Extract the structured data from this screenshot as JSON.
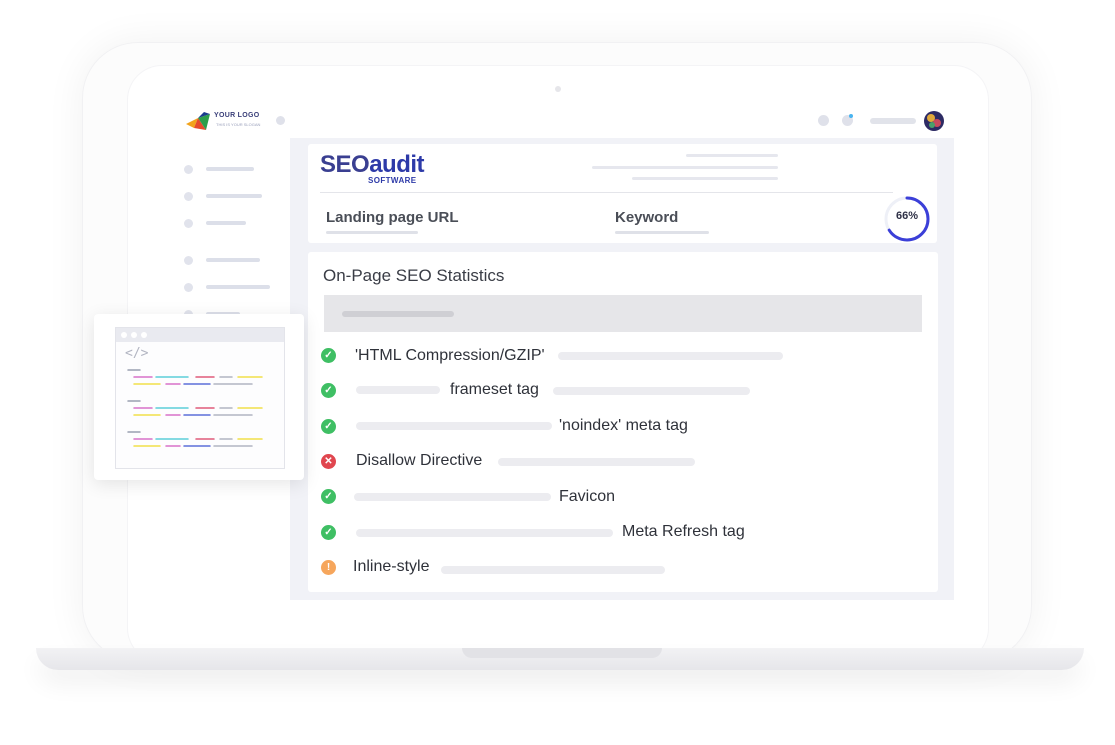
{
  "topbar": {
    "logo_text": "YOUR LOGO",
    "logo_tagline": "THIS IS YOUR SLOGAN",
    "notification_color": "#49b4f0"
  },
  "brand": {
    "seo_word": "SEO",
    "audit_word": "audit",
    "software_word": "SOFTWARE"
  },
  "inputs": {
    "landing_label": "Landing page URL",
    "keyword_label": "Keyword",
    "progress_text": "66%",
    "progress_value": 66
  },
  "section": {
    "title": "On-Page SEO Statistics"
  },
  "checks": [
    {
      "label": "'HTML Compression/GZIP'",
      "status": "pass"
    },
    {
      "label": "frameset tag",
      "status": "pass"
    },
    {
      "label": "'noindex' meta tag",
      "status": "pass"
    },
    {
      "label": "Disallow Directive",
      "status": "fail"
    },
    {
      "label": "Favicon",
      "status": "pass"
    },
    {
      "label": "Meta Refresh tag",
      "status": "pass"
    },
    {
      "label": "Inline-style",
      "status": "warning"
    }
  ],
  "code_snippet": {
    "tag": "</>"
  },
  "colors": {
    "accent": "#3b3fd8",
    "pass": "#3fbf64",
    "fail": "#e0464f",
    "warning": "#f6a65c"
  },
  "icons": {
    "pass": "check-circle-icon",
    "fail": "x-circle-icon",
    "warning": "exclamation-circle-icon"
  }
}
